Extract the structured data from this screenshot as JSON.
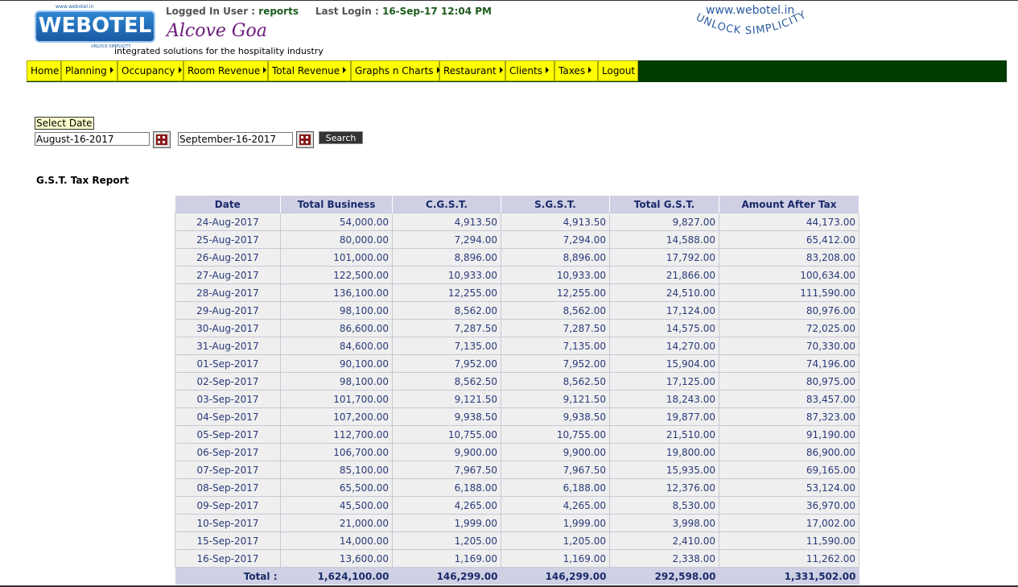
{
  "header": {
    "logo_text": "WEBOTEL",
    "logo_caption": "www.webotel.in",
    "logo_tagline": "UNLOCK SIMPLICITY",
    "logged_in_label": "Logged In User :",
    "logged_in_user": "reports",
    "last_login_label": "Last Login :",
    "last_login_value": "16-Sep-17 12:04 PM",
    "hotel_name": "Alcove Goa",
    "tagline": "integrated solutions for the hospitality industry",
    "site_url": "www.webotel.in",
    "site_slogan": "UNLOCK SIMPLICITY"
  },
  "menu": [
    {
      "label": "Home",
      "arrow": false
    },
    {
      "label": "Planning",
      "arrow": true
    },
    {
      "label": "Occupancy",
      "arrow": true
    },
    {
      "label": "Room Revenue",
      "arrow": true
    },
    {
      "label": "Total Revenue",
      "arrow": true
    },
    {
      "label": "Graphs n Charts",
      "arrow": true
    },
    {
      "label": "Restaurant",
      "arrow": true
    },
    {
      "label": "Clients",
      "arrow": true
    },
    {
      "label": "Taxes",
      "arrow": true
    },
    {
      "label": "Logout",
      "arrow": false
    }
  ],
  "form": {
    "select_date_label": "Select Date",
    "from_date": "August-16-2017",
    "to_date": "September-16-2017",
    "search_label": "Search"
  },
  "report": {
    "title": "G.S.T. Tax Report",
    "columns": [
      "Date",
      "Total Business",
      "C.G.S.T.",
      "S.G.S.T.",
      "Total G.S.T.",
      "Amount After Tax"
    ],
    "rows": [
      [
        "24-Aug-2017",
        "54,000.00",
        "4,913.50",
        "4,913.50",
        "9,827.00",
        "44,173.00"
      ],
      [
        "25-Aug-2017",
        "80,000.00",
        "7,294.00",
        "7,294.00",
        "14,588.00",
        "65,412.00"
      ],
      [
        "26-Aug-2017",
        "101,000.00",
        "8,896.00",
        "8,896.00",
        "17,792.00",
        "83,208.00"
      ],
      [
        "27-Aug-2017",
        "122,500.00",
        "10,933.00",
        "10,933.00",
        "21,866.00",
        "100,634.00"
      ],
      [
        "28-Aug-2017",
        "136,100.00",
        "12,255.00",
        "12,255.00",
        "24,510.00",
        "111,590.00"
      ],
      [
        "29-Aug-2017",
        "98,100.00",
        "8,562.00",
        "8,562.00",
        "17,124.00",
        "80,976.00"
      ],
      [
        "30-Aug-2017",
        "86,600.00",
        "7,287.50",
        "7,287.50",
        "14,575.00",
        "72,025.00"
      ],
      [
        "31-Aug-2017",
        "84,600.00",
        "7,135.00",
        "7,135.00",
        "14,270.00",
        "70,330.00"
      ],
      [
        "01-Sep-2017",
        "90,100.00",
        "7,952.00",
        "7,952.00",
        "15,904.00",
        "74,196.00"
      ],
      [
        "02-Sep-2017",
        "98,100.00",
        "8,562.50",
        "8,562.50",
        "17,125.00",
        "80,975.00"
      ],
      [
        "03-Sep-2017",
        "101,700.00",
        "9,121.50",
        "9,121.50",
        "18,243.00",
        "83,457.00"
      ],
      [
        "04-Sep-2017",
        "107,200.00",
        "9,938.50",
        "9,938.50",
        "19,877.00",
        "87,323.00"
      ],
      [
        "05-Sep-2017",
        "112,700.00",
        "10,755.00",
        "10,755.00",
        "21,510.00",
        "91,190.00"
      ],
      [
        "06-Sep-2017",
        "106,700.00",
        "9,900.00",
        "9,900.00",
        "19,800.00",
        "86,900.00"
      ],
      [
        "07-Sep-2017",
        "85,100.00",
        "7,967.50",
        "7,967.50",
        "15,935.00",
        "69,165.00"
      ],
      [
        "08-Sep-2017",
        "65,500.00",
        "6,188.00",
        "6,188.00",
        "12,376.00",
        "53,124.00"
      ],
      [
        "09-Sep-2017",
        "45,500.00",
        "4,265.00",
        "4,265.00",
        "8,530.00",
        "36,970.00"
      ],
      [
        "10-Sep-2017",
        "21,000.00",
        "1,999.00",
        "1,999.00",
        "3,998.00",
        "17,002.00"
      ],
      [
        "15-Sep-2017",
        "14,000.00",
        "1,205.00",
        "1,205.00",
        "2,410.00",
        "11,590.00"
      ],
      [
        "16-Sep-2017",
        "13,600.00",
        "1,169.00",
        "1,169.00",
        "2,338.00",
        "11,262.00"
      ]
    ],
    "total": [
      "Total :",
      "1,624,100.00",
      "146,299.00",
      "146,299.00",
      "292,598.00",
      "1,331,502.00"
    ]
  },
  "colors": {
    "menu_bg": "#ffff00",
    "menubar_bg": "#003b00",
    "header_cell_bg": "#cfd0e4",
    "hotel_name": "#6b1a7a"
  }
}
